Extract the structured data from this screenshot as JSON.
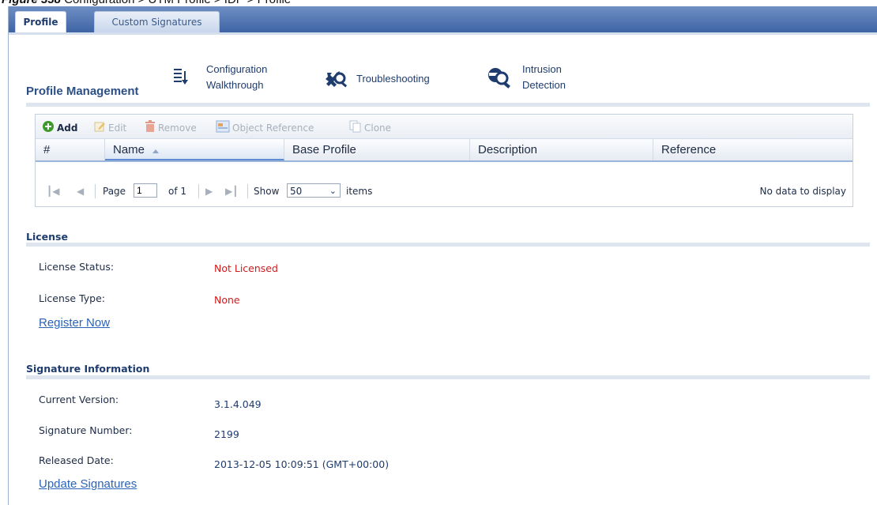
{
  "caption": {
    "figure": "Figure 338",
    "text": "Configuration > UTM Profile > IDP > Profile"
  },
  "tabs": [
    {
      "label": "Profile",
      "active": true
    },
    {
      "label": "Custom Signatures",
      "active": false
    }
  ],
  "profile_management": {
    "title": "Profile Management",
    "wizards": [
      {
        "line1": "Configuration",
        "line2": "Walkthrough",
        "icon": "list-sort-icon"
      },
      {
        "line1": "Troubleshooting",
        "line2": "",
        "icon": "wrench-magnifier-icon"
      },
      {
        "line1": "Intrusion",
        "line2": "Detection",
        "icon": "intrusion-magnifier-icon"
      }
    ],
    "toolbar": {
      "add": "Add",
      "edit": "Edit",
      "remove": "Remove",
      "object_reference": "Object Reference",
      "clone": "Clone"
    },
    "columns": [
      "#",
      "Name",
      "Base Profile",
      "Description",
      "Reference"
    ],
    "sort_column": "Name",
    "sort_direction": "ascending",
    "rows": [],
    "pager": {
      "page_label": "Page",
      "page_value": "1",
      "of_label": "of 1",
      "show_label": "Show",
      "show_value": "50",
      "items_label": "items",
      "empty_text": "No data to display"
    }
  },
  "license": {
    "title": "License",
    "status_label": "License Status:",
    "status_value": "Not Licensed",
    "type_label": "License Type:",
    "type_value": "None",
    "register_link": "Register Now"
  },
  "signature": {
    "title": "Signature Information",
    "version_label": "Current Version:",
    "version_value": "3.1.4.049",
    "number_label": "Signature Number:",
    "number_value": "2199",
    "date_label": "Released Date:",
    "date_value": "2013-12-05 10:09:51 (GMT+00:00)",
    "update_link": "Update Signatures"
  },
  "colors": {
    "tabbar": "#3f64a4",
    "alert": "#d11c1c",
    "link": "#2a64b8",
    "label": "#1f3c6e"
  }
}
